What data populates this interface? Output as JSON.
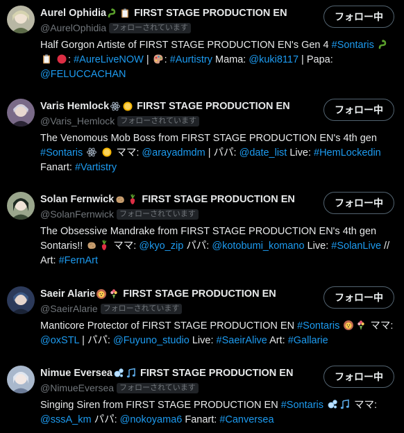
{
  "follow_button_label": "フォロー中",
  "follows_you_label": "フォローされています",
  "accent_color": "#1d9bf0",
  "users": [
    {
      "name": "Aurel Ophidia",
      "org": "FIRST STAGE PRODUCTION EN",
      "handle": "@AurelOphidia",
      "name_icons": [
        "snake-icon",
        "clipboard-icon"
      ],
      "bio": [
        {
          "t": "Half Gorgon Artiste of FIRST STAGE PRODUCTION EN's Gen 4 "
        },
        {
          "t": "#Sontaris",
          "link": true
        },
        {
          "t": " "
        },
        {
          "icon": "snake-icon"
        },
        {
          "t": " "
        },
        {
          "icon": "clipboard-icon"
        },
        {
          "t": " "
        },
        {
          "icon": "red-circle-icon"
        },
        {
          "t": ": "
        },
        {
          "t": "#AureLiveNOW",
          "link": true
        },
        {
          "t": " | "
        },
        {
          "icon": "palette-icon"
        },
        {
          "t": ": "
        },
        {
          "t": "#Aurtistry",
          "link": true
        },
        {
          "t": " Mama: "
        },
        {
          "t": "@kuki8117",
          "link": true
        },
        {
          "t": " | Papa: "
        },
        {
          "t": "@FELUCCACHAN",
          "link": true
        }
      ]
    },
    {
      "name": "Varis Hemlock",
      "org": "FIRST STAGE PRODUCTION EN",
      "handle": "@Varis_Hemlock",
      "name_icons": [
        "atom-icon",
        "coin-icon"
      ],
      "bio": [
        {
          "t": "The Venomous Mob Boss from FIRST STAGE PRODUCTION EN's 4th gen "
        },
        {
          "t": "#Sontaris",
          "link": true
        },
        {
          "t": " "
        },
        {
          "icon": "atom-icon"
        },
        {
          "t": " "
        },
        {
          "icon": "coin-icon"
        },
        {
          "t": " ママ: "
        },
        {
          "t": "@arayadmdm",
          "link": true
        },
        {
          "t": " | パパ: "
        },
        {
          "t": "@date_list",
          "link": true
        },
        {
          "t": " Live: "
        },
        {
          "t": "#HemLockedin",
          "link": true
        },
        {
          "t": " Fanart: "
        },
        {
          "t": "#Vartistry",
          "link": true
        }
      ]
    },
    {
      "name": "Solan Fernwick",
      "org": "FIRST STAGE PRODUCTION EN",
      "handle": "@SolanFernwick",
      "name_icons": [
        "potato-icon",
        "radish-icon"
      ],
      "bio": [
        {
          "t": "The Obsessive Mandrake from FIRST STAGE PRODUCTION EN's 4th gen Sontaris!! "
        },
        {
          "icon": "potato-icon"
        },
        {
          "icon": "radish-icon"
        },
        {
          "t": " ママ: "
        },
        {
          "t": "@kyo_zip",
          "link": true
        },
        {
          "t": " パパ: "
        },
        {
          "t": "@kotobumi_komano",
          "link": true
        },
        {
          "t": " Live: "
        },
        {
          "t": "#SolanLive",
          "link": true
        },
        {
          "t": " // Art: "
        },
        {
          "t": "#FernArt",
          "link": true
        }
      ]
    },
    {
      "name": "Saeir Alarie",
      "org": "FIRST STAGE PRODUCTION EN",
      "handle": "@SaeirAlarie",
      "name_icons": [
        "lion-icon",
        "bouquet-icon"
      ],
      "bio": [
        {
          "t": "Manticore Protector of FIRST STAGE PRODUCTION EN "
        },
        {
          "t": "#Sontaris",
          "link": true
        },
        {
          "t": " "
        },
        {
          "icon": "lion-icon"
        },
        {
          "icon": "bouquet-icon"
        },
        {
          "t": " ママ: "
        },
        {
          "t": "@oxSTL",
          "link": true
        },
        {
          "t": " | パパ: "
        },
        {
          "t": "@Fuyuno_studio",
          "link": true
        },
        {
          "t": " Live: "
        },
        {
          "t": "#SaeirAlive",
          "link": true
        },
        {
          "t": " Art: "
        },
        {
          "t": "#Gallarie",
          "link": true
        }
      ]
    },
    {
      "name": "Nimue Eversea",
      "org": "FIRST STAGE PRODUCTION EN",
      "handle": "@NimueEversea",
      "name_icons": [
        "bubbles-icon",
        "notes-icon"
      ],
      "bio": [
        {
          "t": "Singing Siren from FIRST STAGE PRODUCTION EN "
        },
        {
          "t": "#Sontaris",
          "link": true
        },
        {
          "t": " "
        },
        {
          "icon": "bubbles-icon"
        },
        {
          "icon": "notes-icon"
        },
        {
          "t": " ママ: "
        },
        {
          "t": "@sssA_km",
          "link": true
        },
        {
          "t": " パパ: "
        },
        {
          "t": "@nokoyama6",
          "link": true
        },
        {
          "t": " Fanart: "
        },
        {
          "t": "#Canversea",
          "link": true
        }
      ]
    }
  ]
}
